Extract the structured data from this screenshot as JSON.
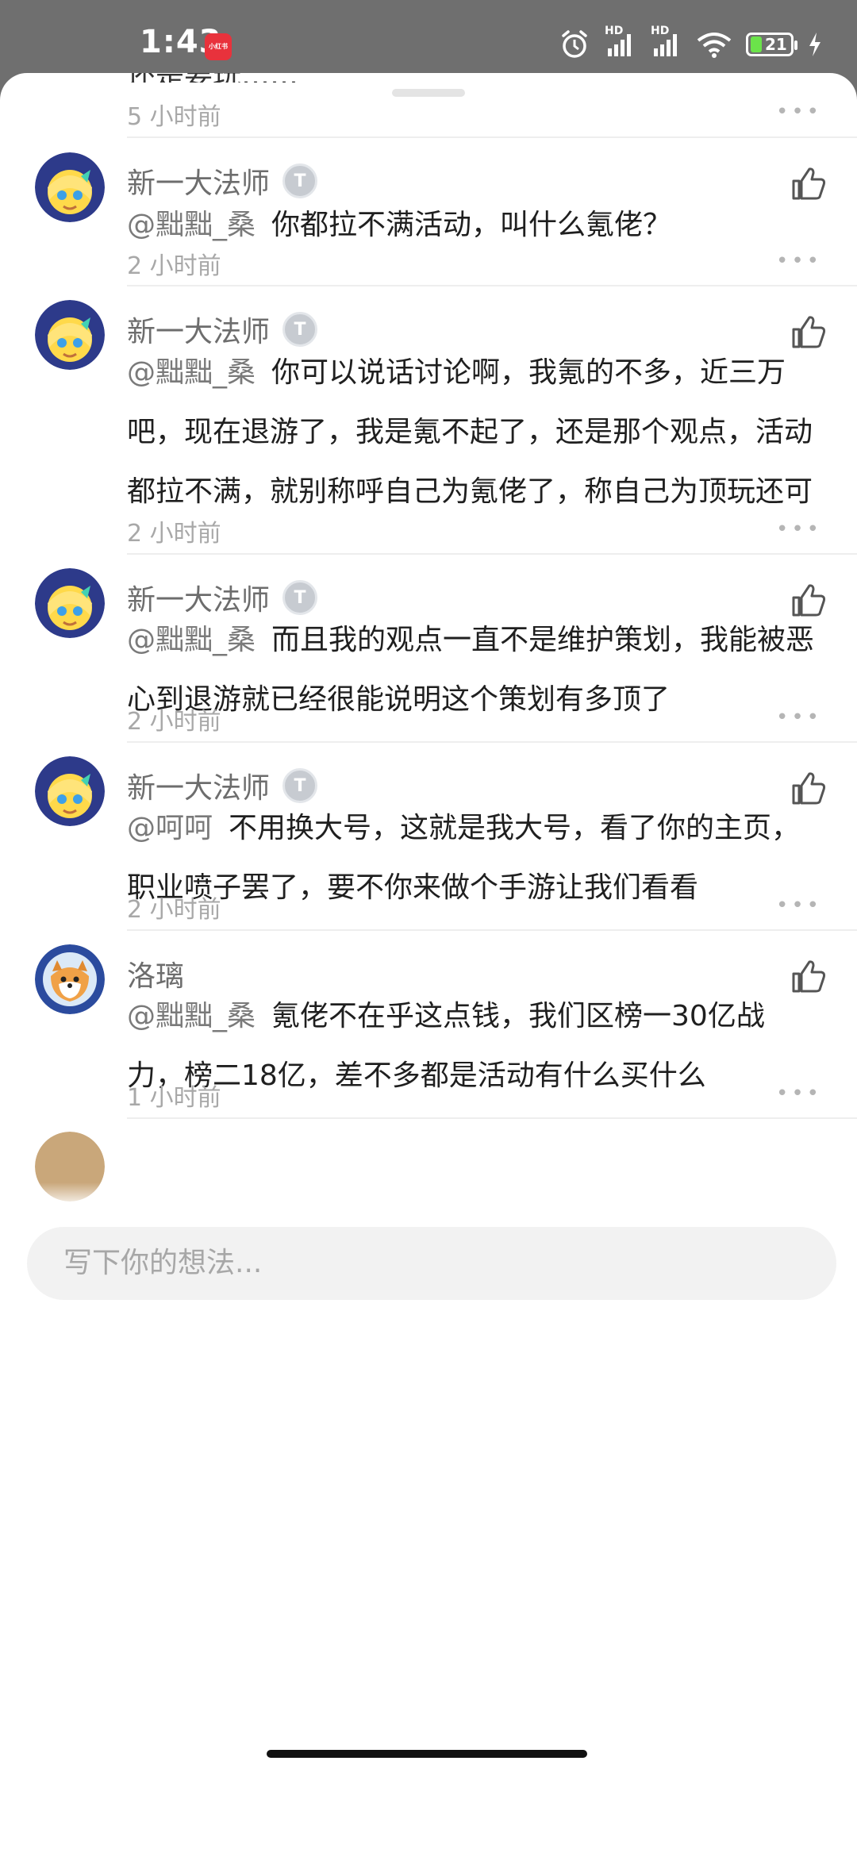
{
  "status_bar": {
    "time": "1:43",
    "app_badge_text": "小红书",
    "signal_labels": [
      "HD",
      "HD"
    ],
    "battery_level": "21"
  },
  "partial_comment": {
    "text": "还是要玩……",
    "time_ago": "5 小时前"
  },
  "comments": [
    {
      "username": "新一大法师",
      "badge": "T",
      "mention": "@黜黜_桑",
      "text": "你都拉不满活动，叫什么氪佬？",
      "time_ago": "2 小时前"
    },
    {
      "username": "新一大法师",
      "badge": "T",
      "mention": "@黜黜_桑",
      "text": "你可以说话讨论啊，我氪的不多，近三万吧，现在退游了，我是氪不起了，还是那个观点，活动都拉不满，就别称呼自己为氪佬了，称自己为顶玩还可",
      "time_ago": "2 小时前"
    },
    {
      "username": "新一大法师",
      "badge": "T",
      "mention": "@黜黜_桑",
      "text": "而且我的观点一直不是维护策划，我能被恶心到退游就已经很能说明这个策划有多顶了",
      "time_ago": "2 小时前"
    },
    {
      "username": "新一大法师",
      "badge": "T",
      "mention": "@呵呵",
      "text": "不用换大号，这就是我大号，看了你的主页，职业喷子罢了，要不你来做个手游让我们看看",
      "time_ago": "2 小时前"
    },
    {
      "username": "洛璃",
      "badge": "",
      "mention": "@黜黜_桑",
      "text": "氪佬不在乎这点钱，我们区榜一30亿战力，榜二18亿，差不多都是活动有什么买什么",
      "time_ago": "1 小时前"
    }
  ],
  "more_label": "•••",
  "input": {
    "placeholder": "写下你的想法..."
  },
  "icons": {
    "like": "thumbs-up-icon",
    "more": "more-dots-icon",
    "wifi": "wifi-icon",
    "alarm": "alarm-icon",
    "charging": "bolt-icon"
  }
}
